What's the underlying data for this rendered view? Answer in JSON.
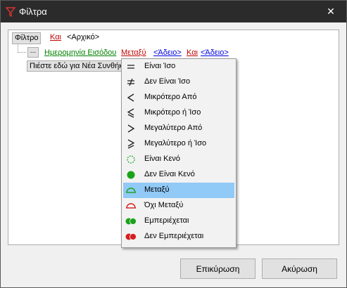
{
  "window": {
    "title": "Φίλτρα"
  },
  "filter": {
    "root_label": "Φίλτρο",
    "root_operator": "Και",
    "root_value": "<Αρχικό>",
    "condition": {
      "dots": "...",
      "field": "Ημερομηνία Εισόδου",
      "operator": "Μεταξύ",
      "value1": "<Άδειο>",
      "joiner": "Και",
      "value2": "<Άδειο>"
    },
    "new_condition": "Πιέστε εδώ για Νέα Συνθήκη"
  },
  "menu": {
    "items": [
      {
        "label": "Είναι Ίσο",
        "icon": "equals-icon"
      },
      {
        "label": "Δεν Είναι Ίσο",
        "icon": "not-equals-icon"
      },
      {
        "label": "Μικρότερο Από",
        "icon": "less-than-icon"
      },
      {
        "label": "Μικρότερο ή Ίσο",
        "icon": "less-or-equal-icon"
      },
      {
        "label": "Μεγαλύτερο Από",
        "icon": "greater-than-icon"
      },
      {
        "label": "Μεγαλύτερο ή Ίσο",
        "icon": "greater-or-equal-icon"
      },
      {
        "label": "Είναι Κενό",
        "icon": "empty-circle-icon"
      },
      {
        "label": "Δεν Είναι Κενό",
        "icon": "filled-circle-icon"
      },
      {
        "label": "Μεταξύ",
        "icon": "between-icon",
        "selected": true
      },
      {
        "label": "Όχι Μεταξύ",
        "icon": "not-between-icon"
      },
      {
        "label": "Εμπεριέχεται",
        "icon": "contains-icon"
      },
      {
        "label": "Δεν Εμπεριέχεται",
        "icon": "not-contains-icon"
      }
    ]
  },
  "buttons": {
    "ok": "Επικύρωση",
    "cancel": "Ακύρωση"
  },
  "colors": {
    "titlebar": "#2b2b2b",
    "selection": "#91c9f7",
    "operator": "#c00000",
    "value": "#0000e0",
    "field": "#008000",
    "green_icon": "#1aa31a",
    "red_icon": "#d42020"
  }
}
